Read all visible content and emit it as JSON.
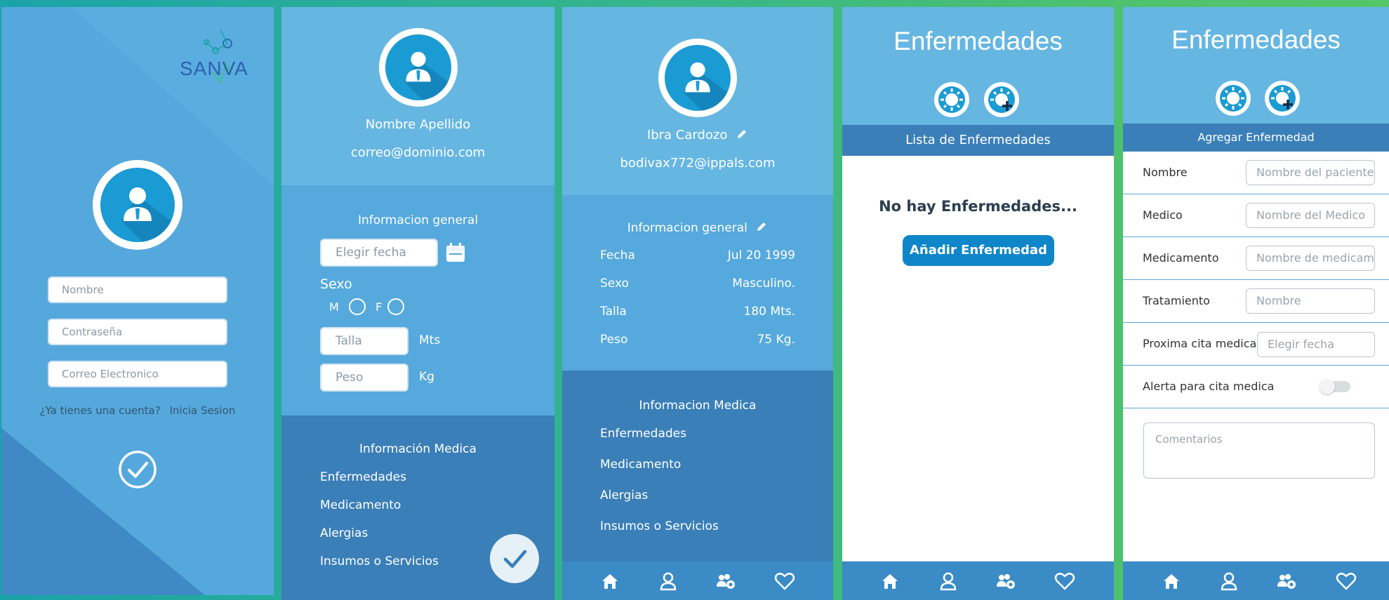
{
  "login": {
    "logo_text": "SANVA",
    "name_placeholder": "Nombre",
    "password_placeholder": "Contraseña",
    "email_placeholder": "Correo Electronico",
    "have_account": "¿Ya tienes una cuenta?",
    "login_link": "Inicia Sesion"
  },
  "register": {
    "name": "Nombre Apellido",
    "email": "correo@dominio.com",
    "general_title": "Informacion general",
    "date_placeholder": "Elegir fecha",
    "sex_label": "Sexo",
    "sex_m": "M",
    "sex_f": "F",
    "height_placeholder": "Talla",
    "height_unit": "Mts",
    "weight_placeholder": "Peso",
    "weight_unit": "Kg",
    "medical_title": "Información Medica",
    "medical_items": [
      "Enfermedades",
      "Medicamento",
      "Alergias",
      "Insumos o Servicios"
    ]
  },
  "profile": {
    "name": "Ibra Cardozo",
    "email": "bodivax772@ippals.com",
    "general_title": "Informacion general",
    "fields": [
      {
        "label": "Fecha",
        "value": "Jul 20 1999"
      },
      {
        "label": "Sexo",
        "value": "Masculino."
      },
      {
        "label": "Talla",
        "value": "180 Mts."
      },
      {
        "label": "Peso",
        "value": "75 Kg."
      }
    ],
    "medical_title": "Informacion Medica",
    "medical_items": [
      "Enfermedades",
      "Medicamento",
      "Alergias",
      "Insumos o Servicios"
    ]
  },
  "diseases": {
    "title": "Enfermedades",
    "subheader": "Lista de Enfermedades",
    "empty_text": "No hay Enfermedades...",
    "add_button": "Añadir Enfermedad"
  },
  "add_disease": {
    "title": "Enfermedades",
    "subheader": "Agregar Enfermedad",
    "fields": [
      {
        "label": "Nombre",
        "placeholder": "Nombre del paciente"
      },
      {
        "label": "Medico",
        "placeholder": "Nombre del Medico"
      },
      {
        "label": "Medicamento",
        "placeholder": "Nombre de medicamento"
      },
      {
        "label": "Tratamiento",
        "placeholder": "Nombre"
      },
      {
        "label": "Proxima cita medica",
        "placeholder": "Elegir fecha"
      }
    ],
    "alert_label": "Alerta para cita medica",
    "comments_placeholder": "Comentarios"
  },
  "nav_icons": [
    "home-icon",
    "user-icon",
    "group-settings-icon",
    "heart-icon"
  ],
  "colors": {
    "primary": "#56a9dc",
    "dark": "#3a7fb8",
    "button": "#0f86c9",
    "avatar": "#1a9bd3",
    "background_green": "#4ec16e"
  }
}
